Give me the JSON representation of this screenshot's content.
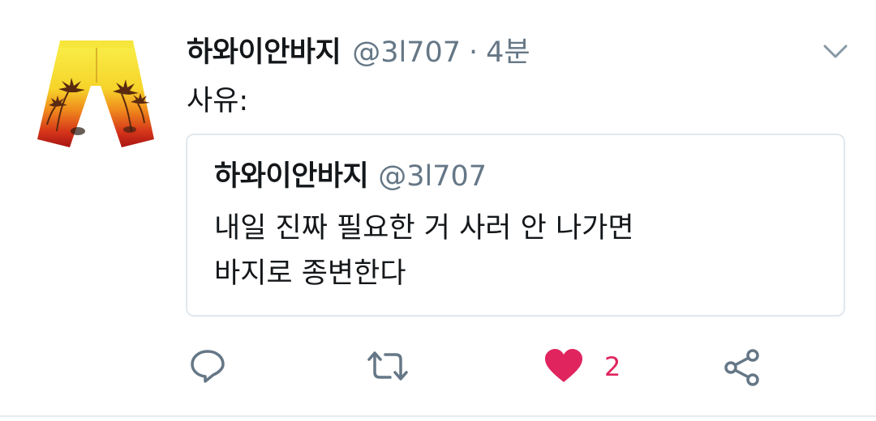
{
  "tweet": {
    "display_name": "하와이안바지",
    "handle": "@3l707",
    "separator": "·",
    "time": "4분",
    "text": "사유:"
  },
  "quote": {
    "display_name": "하와이안바지",
    "handle": "@3l707",
    "lines": [
      "내일 진짜 필요한 거 사러 안 나가면",
      "바지로 종변한다"
    ]
  },
  "actions": {
    "like_count": "2"
  },
  "icons": {
    "avatar": "hawaiian-shorts-avatar",
    "caret": "chevron-down-icon",
    "reply": "reply-icon",
    "retweet": "retweet-icon",
    "like": "heart-icon",
    "share": "share-icon"
  },
  "colors": {
    "text": "#14171a",
    "secondary": "#657786",
    "border": "#e1e8ed",
    "like": "#e0245e"
  }
}
